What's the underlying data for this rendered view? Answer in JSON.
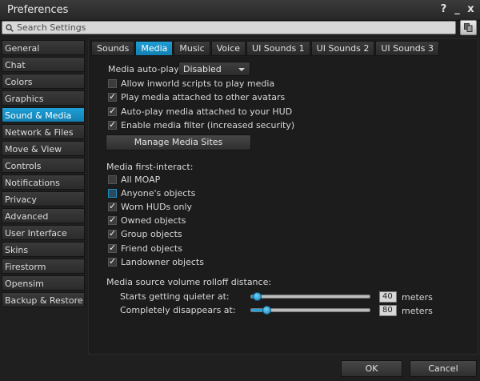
{
  "window": {
    "title": "Preferences",
    "help": "?",
    "minimize": "_",
    "close": "x"
  },
  "search": {
    "placeholder": "Search Settings",
    "value": ""
  },
  "sidebar": {
    "items": [
      {
        "label": "General"
      },
      {
        "label": "Chat"
      },
      {
        "label": "Colors"
      },
      {
        "label": "Graphics"
      },
      {
        "label": "Sound & Media",
        "active": true
      },
      {
        "label": "Network & Files"
      },
      {
        "label": "Move & View"
      },
      {
        "label": "Controls"
      },
      {
        "label": "Notifications"
      },
      {
        "label": "Privacy"
      },
      {
        "label": "Advanced"
      },
      {
        "label": "User Interface"
      },
      {
        "label": "Skins"
      },
      {
        "label": "Firestorm"
      },
      {
        "label": "Opensim"
      },
      {
        "label": "Backup & Restore"
      }
    ]
  },
  "tabs": [
    {
      "label": "Sounds"
    },
    {
      "label": "Media",
      "active": true
    },
    {
      "label": "Music"
    },
    {
      "label": "Voice"
    },
    {
      "label": "UI Sounds 1"
    },
    {
      "label": "UI Sounds 2"
    },
    {
      "label": "UI Sounds 3"
    }
  ],
  "media": {
    "autoplay_label": "Media auto-play",
    "autoplay_value": "Disabled",
    "options": [
      {
        "label": "Allow inworld scripts to play media",
        "checked": false
      },
      {
        "label": "Play media attached to other avatars",
        "checked": true
      },
      {
        "label": "Auto-play media attached to your HUD",
        "checked": true
      },
      {
        "label": "Enable media filter (increased security)",
        "checked": true
      }
    ],
    "manage_button": "Manage Media Sites",
    "first_interact_label": "Media first-interact:",
    "first_interact": [
      {
        "label": "All MOAP",
        "checked": false
      },
      {
        "label": "Anyone's objects",
        "checked": false,
        "highlight": true
      },
      {
        "label": "Worn HUDs only",
        "checked": true
      },
      {
        "label": "Owned objects",
        "checked": true
      },
      {
        "label": "Group objects",
        "checked": true
      },
      {
        "label": "Friend objects",
        "checked": true
      },
      {
        "label": "Landowner objects",
        "checked": true
      }
    ],
    "rolloff_label": "Media source volume rolloff distance:",
    "quieter_label": "Starts getting quieter at:",
    "quieter_value": "40",
    "disappears_label": "Completely disappears at:",
    "disappears_value": "80",
    "units": "meters"
  },
  "footer": {
    "ok": "OK",
    "cancel": "Cancel"
  },
  "colors": {
    "accent": "#1e9fd6"
  }
}
